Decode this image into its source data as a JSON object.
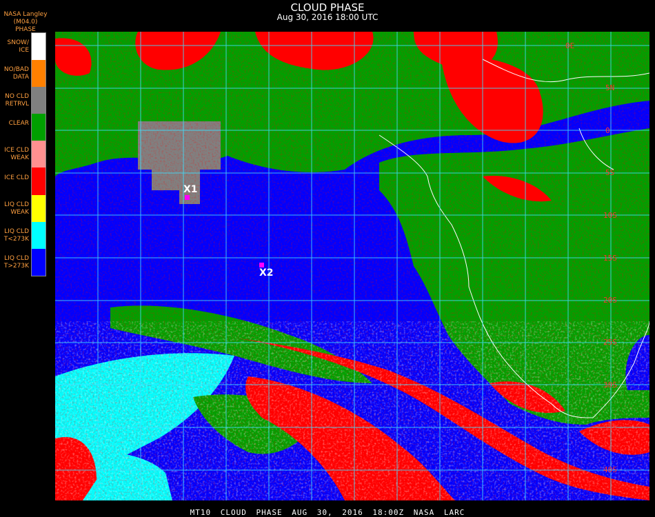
{
  "header": {
    "title": "CLOUD PHASE",
    "subtitle": "Aug 30, 2016 18:00 UTC",
    "org": "NASA Langley (M04.0)",
    "legend_title": "PHASE"
  },
  "legend": [
    {
      "label": "SNOW/\nICE",
      "color": "#ffffff"
    },
    {
      "label": "NO/BAD\nDATA",
      "color": "#ff8000"
    },
    {
      "label": "NO CLD\nRETRVL",
      "color": "#808080"
    },
    {
      "label": "CLEAR",
      "color": "#00a000"
    },
    {
      "label": "ICE CLD\nWEAK",
      "color": "#ff9090"
    },
    {
      "label": "ICE CLD",
      "color": "#ff0000"
    },
    {
      "label": "LIQ CLD\nWEAK",
      "color": "#ffff00"
    },
    {
      "label": "LIQ CLD\nT<273K",
      "color": "#00ffff"
    },
    {
      "label": "LIQ CLD\nT>273K",
      "color": "#0000ff"
    }
  ],
  "markers": [
    {
      "label": "X1"
    },
    {
      "label": "X2"
    }
  ],
  "lat_labels": [
    "0E",
    "5N",
    "0",
    "5S",
    "10S",
    "15S",
    "20S",
    "25S",
    "30S",
    "35S",
    "40S"
  ],
  "footer": "MT10  CLOUD PHASE  AUG 30, 2016 18:00Z  NASA LARC",
  "colors": {
    "grid": "#40e0ff",
    "coast": "#ffffff",
    "marker": "#ff00ff"
  }
}
